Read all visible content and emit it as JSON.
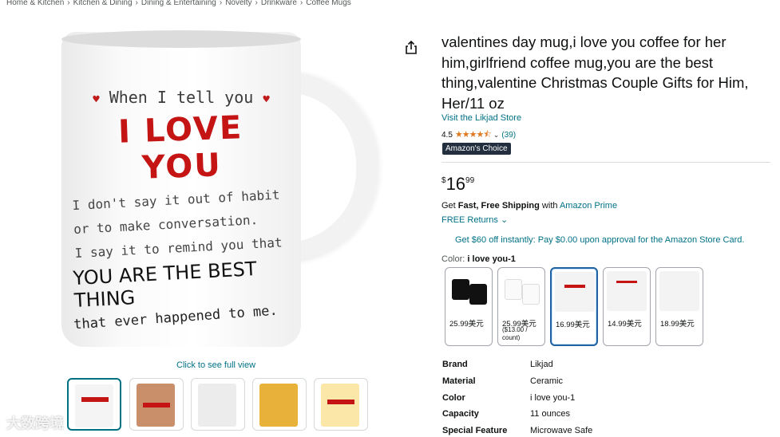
{
  "breadcrumb": [
    "Home & Kitchen",
    "Kitchen & Dining",
    "Dining & Entertaining",
    "Novelty",
    "Drinkware",
    "Coffee Mugs"
  ],
  "breadcrumb_sep": "›",
  "product_image": {
    "line1": "When I tell you",
    "love": "I LOVE YOU",
    "body_lines": [
      "I don't say it out of habit",
      "or to make conversation.",
      "I say it to remind you that"
    ],
    "best": "YOU ARE THE BEST THING",
    "last": "that ever happened to me."
  },
  "full_view_link": "Click to see full view",
  "thumbnails": [
    {
      "selected": true
    },
    {
      "selected": false
    },
    {
      "selected": false
    },
    {
      "selected": false
    },
    {
      "selected": false
    }
  ],
  "title": "valentines day mug,i love you coffee for her him,girlfriend coffee mug,you are the best thing,valentine Christmas Couple Gifts for Him, Her/11 oz",
  "store_link": "Visit the Likjad Store",
  "rating": {
    "value": "4.5",
    "stars": "★★★★⯪",
    "count": "(39)"
  },
  "badge": "Amazon's Choice",
  "price": {
    "currency": "$",
    "whole": "16",
    "fraction": "99"
  },
  "shipping": {
    "prefix": "Get ",
    "bold": "Fast, Free Shipping",
    "mid": " with ",
    "link": "Amazon Prime"
  },
  "returns": "FREE Returns",
  "promo": "Get $60 off instantly: Pay $0.00 upon approval for the Amazon Store Card.",
  "color": {
    "label": "Color: ",
    "value": "i love you-1"
  },
  "variants": [
    {
      "price": "25.99美元",
      "sub": "",
      "selected": false
    },
    {
      "price": "25.99美元",
      "sub": "($13.00 / count)",
      "selected": false
    },
    {
      "price": "16.99美元",
      "sub": "",
      "selected": true
    },
    {
      "price": "14.99美元",
      "sub": "",
      "selected": false
    },
    {
      "price": "18.99美元",
      "sub": "",
      "selected": false
    }
  ],
  "specs": [
    {
      "key": "Brand",
      "value": "Likjad"
    },
    {
      "key": "Material",
      "value": "Ceramic"
    },
    {
      "key": "Color",
      "value": "i love you-1"
    },
    {
      "key": "Capacity",
      "value": "11 ounces"
    },
    {
      "key": "Special Feature",
      "value": "Microwave Safe"
    }
  ],
  "watermark": "大数跨境",
  "colors": {
    "link": "#007185",
    "star": "#de7921",
    "badge_bg": "#232f3e",
    "selected_border": "#2162a1",
    "mug_red": "#c41414"
  },
  "icons": {
    "share": "share-icon",
    "chevron": "chevron-down-icon"
  }
}
